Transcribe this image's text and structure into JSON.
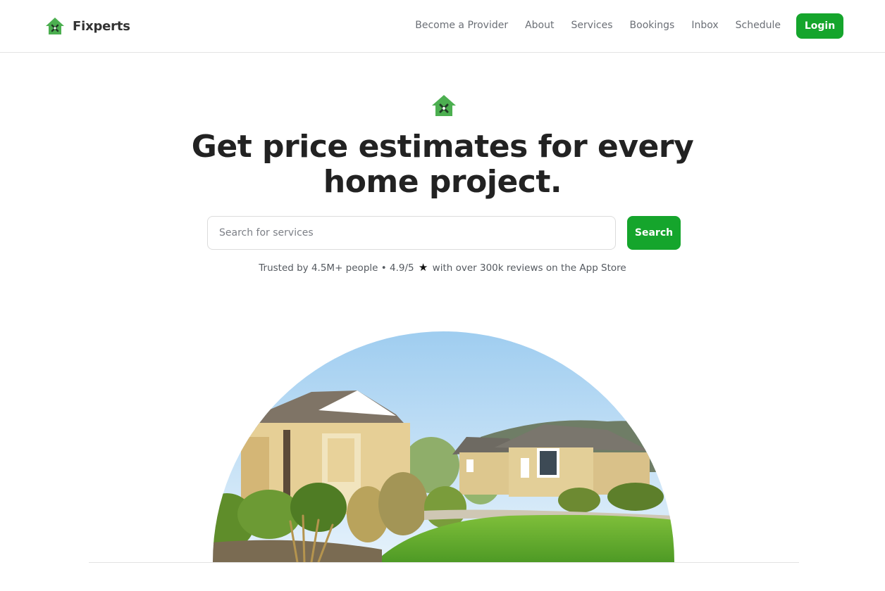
{
  "brand": {
    "name": "Fixperts",
    "icon": "house-tools-icon",
    "color": "#4caf50"
  },
  "nav": {
    "items": [
      "Become a Provider",
      "About",
      "Services",
      "Bookings",
      "Inbox",
      "Schedule"
    ],
    "login_label": "Login"
  },
  "hero": {
    "icon": "house-tools-icon",
    "title_line1": "Get price estimates for every",
    "title_line2": "home project.",
    "search": {
      "placeholder": "Search for services",
      "value": "",
      "button_label": "Search"
    },
    "trust": {
      "text_before_star": "Trusted by 4.5M+ people • 4.9/5",
      "star_icon": "star-icon",
      "text_after_star": "with over 300k reviews on the App Store"
    },
    "image": "house-photo"
  },
  "colors": {
    "accent": "#15a52c",
    "text_dark": "#222222",
    "text_muted": "#6b6f76",
    "border": "#dcdcdc"
  }
}
